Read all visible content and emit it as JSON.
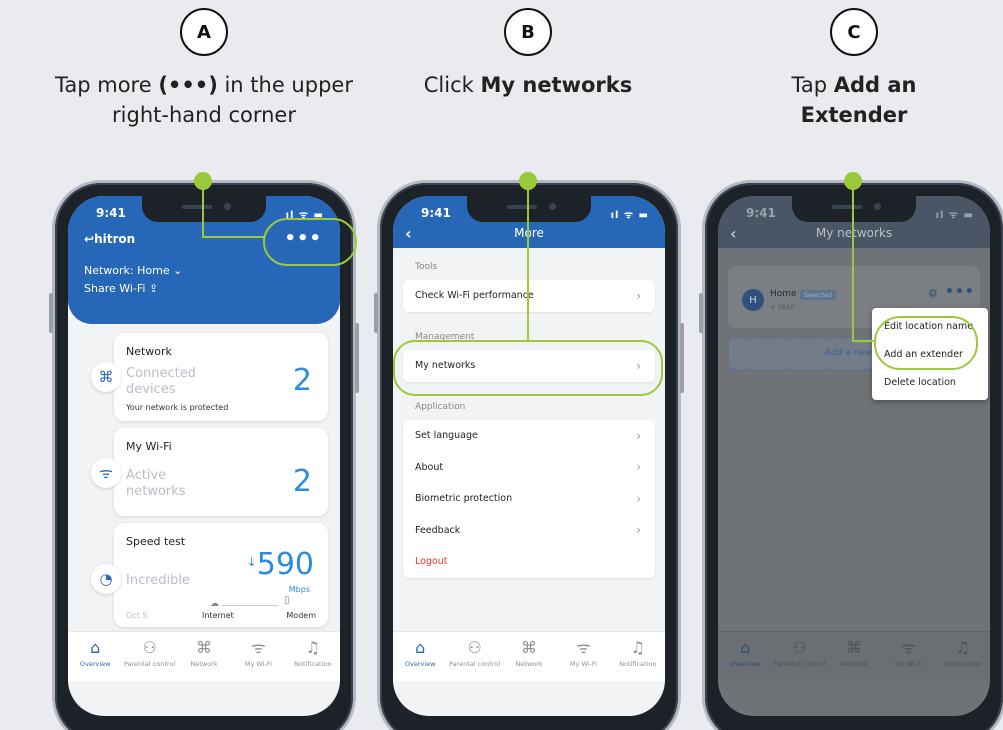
{
  "steps": [
    {
      "letter": "A",
      "text_pre": "Tap more ",
      "text_bold": "(•••)",
      "text_post": " in the upper right-hand corner"
    },
    {
      "letter": "B",
      "text_pre": "Click ",
      "text_bold": "My networks",
      "text_post": ""
    },
    {
      "letter": "C",
      "text_pre": "Tap ",
      "text_bold": "Add an Extender",
      "text_post": ""
    }
  ],
  "status": {
    "time": "9:41",
    "icons": "ıl ᯤ ▬"
  },
  "phone_a": {
    "logo": "hitron",
    "more": "•••",
    "network_label": "Network: Home ⌄",
    "share": "Share Wi-Fi",
    "cards": [
      {
        "title": "Network",
        "sub1": "Connected",
        "sub2": "devices",
        "value": "2",
        "note": "Your network is protected",
        "icon": "network-icon"
      },
      {
        "title": "My Wi-Fi",
        "sub1": "Active",
        "sub2": "networks",
        "value": "2",
        "icon": "wifi-icon"
      },
      {
        "title": "Speed test",
        "sub1": "Incredible",
        "value": "590",
        "unit": "Mbps",
        "date": "Oct 5",
        "left_label": "Internet",
        "right_label": "Modem",
        "icon": "speedometer-icon"
      }
    ]
  },
  "phone_b": {
    "title": "More",
    "sections": [
      {
        "label": "Tools",
        "items": [
          "Check Wi-Fi performance"
        ]
      },
      {
        "label": "Management",
        "items": [
          "My networks"
        ]
      },
      {
        "label": "Application",
        "items": [
          "Set language",
          "About",
          "Biometric protection",
          "Feedback"
        ],
        "logout": "Logout"
      }
    ]
  },
  "phone_c": {
    "title": "My networks",
    "avatar": "H",
    "home": "Home",
    "badge": "Selected",
    "ssid": "5810",
    "add_new": "Add a new lo",
    "menu": [
      "Edit location name",
      "Add an extender",
      "Delete location"
    ]
  },
  "nav": [
    "Overview",
    "Parental control",
    "Network",
    "My Wi-Fi",
    "Notification"
  ],
  "colors": {
    "brand_blue": "#2667b8",
    "highlight_green": "#9cc93c",
    "number_blue": "#2c8de0",
    "logout_red": "#e8322f"
  }
}
